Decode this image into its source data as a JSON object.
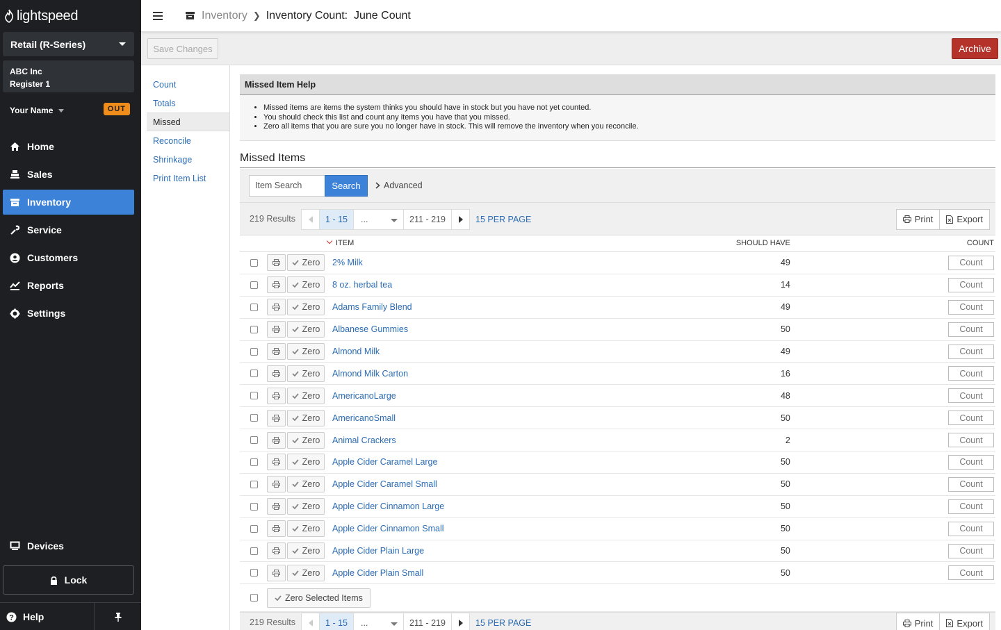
{
  "sidebar": {
    "logo": "lightspeed",
    "store": "Retail (R-Series)",
    "company": "ABC Inc",
    "register": "Register 1",
    "user": "Your Name",
    "status_badge": "OUT",
    "nav": [
      {
        "label": "Home",
        "icon": "home-icon"
      },
      {
        "label": "Sales",
        "icon": "register-icon"
      },
      {
        "label": "Inventory",
        "icon": "inventory-icon",
        "active": true
      },
      {
        "label": "Service",
        "icon": "wrench-icon"
      },
      {
        "label": "Customers",
        "icon": "user-icon"
      },
      {
        "label": "Reports",
        "icon": "chart-icon"
      },
      {
        "label": "Settings",
        "icon": "gear-icon"
      }
    ],
    "devices": "Devices",
    "lock": "Lock",
    "help": "Help"
  },
  "header": {
    "breadcrumb_root": "Inventory",
    "breadcrumb_current": "Inventory Count:  June Count"
  },
  "toolbar": {
    "save_label": "Save Changes",
    "archive_label": "Archive"
  },
  "subnav": [
    "Count",
    "Totals",
    "Missed",
    "Reconcile",
    "Shrinkage",
    "Print Item List"
  ],
  "help": {
    "title": "Missed Item Help",
    "bullets": [
      "Missed items are items the system thinks you should have in stock but you have not yet counted.",
      "You should check this list and count any items you have that you missed.",
      "Zero all items that you are sure you no longer have in stock. This will remove the inventory when you reconcile."
    ]
  },
  "missed": {
    "title": "Missed Items",
    "search_placeholder": "Item Search",
    "search_label": "Search",
    "advanced_label": "Advanced",
    "results": "219 Results",
    "page_current": "1 - 15",
    "page_ellipsis": "...",
    "page_last": "211 - 219",
    "per_page": "15 PER PAGE",
    "print_label": "Print",
    "export_label": "Export",
    "col_item": "ITEM",
    "col_should": "SHOULD HAVE",
    "col_count": "COUNT",
    "zero_label": "Zero",
    "count_label": "Count",
    "zero_selected_label": "Zero Selected Items",
    "rows": [
      {
        "name": "2% Milk",
        "should": "49"
      },
      {
        "name": "8 oz. herbal tea",
        "should": "14"
      },
      {
        "name": "Adams Family Blend",
        "should": "49"
      },
      {
        "name": "Albanese Gummies",
        "should": "50"
      },
      {
        "name": "Almond Milk",
        "should": "49"
      },
      {
        "name": "Almond Milk Carton",
        "should": "16"
      },
      {
        "name": "AmericanoLarge",
        "should": "48"
      },
      {
        "name": "AmericanoSmall",
        "should": "50"
      },
      {
        "name": "Animal Crackers",
        "should": "2"
      },
      {
        "name": "Apple Cider Caramel Large",
        "should": "50"
      },
      {
        "name": "Apple Cider Caramel Small",
        "should": "50"
      },
      {
        "name": "Apple Cider Cinnamon Large",
        "should": "50"
      },
      {
        "name": "Apple Cider Cinnamon Small",
        "should": "50"
      },
      {
        "name": "Apple Cider Plain Large",
        "should": "50"
      },
      {
        "name": "Apple Cider Plain Small",
        "should": "50"
      }
    ]
  }
}
